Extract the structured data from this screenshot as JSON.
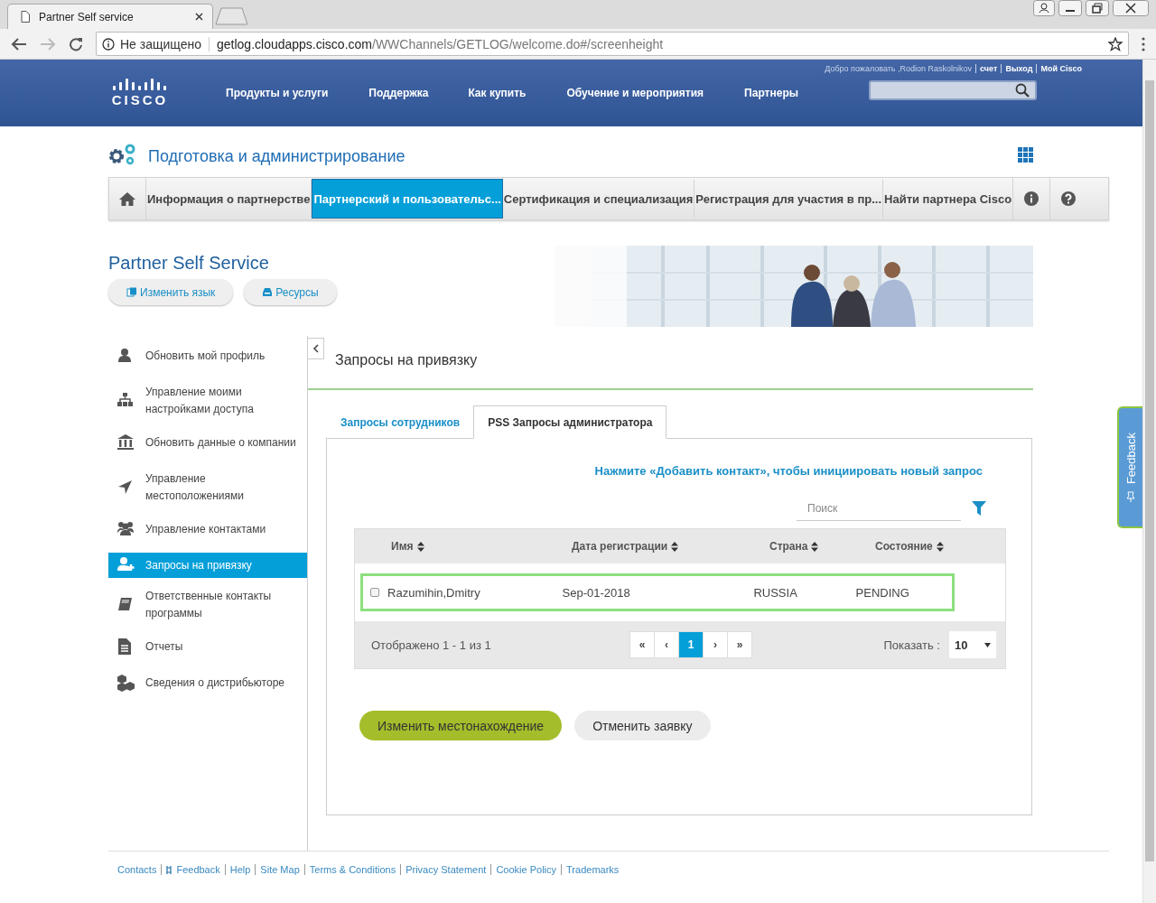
{
  "browser": {
    "tab_title": "Partner Self service",
    "security": "Не защищено",
    "url_host": "getlog.cloudapps.cisco.com",
    "url_path": "/WWChannels/GETLOG/welcome.do#/screenheight"
  },
  "header": {
    "logo": "CISCO",
    "user_links": [
      "Добро пожаловать ,Rodion Raskolnikov",
      "счет",
      "Выход",
      "Мой Cisco"
    ],
    "nav": [
      "Продукты и услуги",
      "Поддержка",
      "Как купить",
      "Обучение и мероприятия",
      "Партнеры"
    ]
  },
  "section_title": "Подготовка и администрирование",
  "nav_tabs": [
    {
      "label": "Информация о партнерстве",
      "selected": false
    },
    {
      "label": "Партнерский и пользовательс...",
      "selected": true
    },
    {
      "label": "Сертификация и специализация",
      "selected": false
    },
    {
      "label": "Регистрация для участия в пр...",
      "selected": false
    },
    {
      "label": "Найти партнера Cisco",
      "selected": false
    }
  ],
  "page_title": "Partner Self Service",
  "page_buttons": [
    "Изменить язык",
    "Ресурсы"
  ],
  "sidebar": {
    "items": [
      {
        "label": "Обновить мой профиль",
        "selected": false
      },
      {
        "label": "Управление моими настройками доступа",
        "selected": false
      },
      {
        "label": "Обновить данные о компании",
        "selected": false
      },
      {
        "label": "Управление местоположениями",
        "selected": false
      },
      {
        "label": "Управление контактами",
        "selected": false
      },
      {
        "label": "Запросы на привязку",
        "selected": true
      },
      {
        "label": "Ответственные контакты программы",
        "selected": false
      },
      {
        "label": "Отчеты",
        "selected": false
      },
      {
        "label": "Сведения о дистрибьюторе",
        "selected": false
      }
    ]
  },
  "main": {
    "title": "Запросы на привязку",
    "tabs": [
      {
        "label": "Запросы сотрудников",
        "selected": false
      },
      {
        "label": "PSS Запросы администратора",
        "selected": true
      }
    ],
    "hint": "Нажмите «Добавить контакт», чтобы инициировать новый запрос",
    "search": {
      "placeholder": "Поиск"
    },
    "table": {
      "columns": [
        "Имя",
        "Дата регистрации",
        "Страна",
        "Состояние"
      ],
      "rows": [
        {
          "checked": false,
          "highlighted": true,
          "cells": [
            "Razumihin,Dmitry",
            "Sep-01-2018",
            "RUSSIA",
            "PENDING"
          ]
        }
      ]
    },
    "summary": "Отображено 1 - 1 из 1",
    "pager": [
      {
        "label": "«",
        "selected": false
      },
      {
        "label": "‹",
        "selected": false
      },
      {
        "label": "1",
        "selected": true
      },
      {
        "label": "›",
        "selected": false
      },
      {
        "label": "»",
        "selected": false
      }
    ],
    "page_size_label": "Показать :",
    "page_size": "10",
    "buttons": [
      {
        "label": "Изменить местонахождение",
        "kind": "primary"
      },
      {
        "label": "Отменить заявку",
        "kind": "secondary"
      }
    ]
  },
  "feedback_tab": "Feedback",
  "footer": {
    "links": [
      "Contacts",
      "Feedback",
      "Help",
      "Site Map",
      "Terms & Conditions",
      "Privacy Statement",
      "Cookie Policy",
      "Trademarks"
    ]
  }
}
